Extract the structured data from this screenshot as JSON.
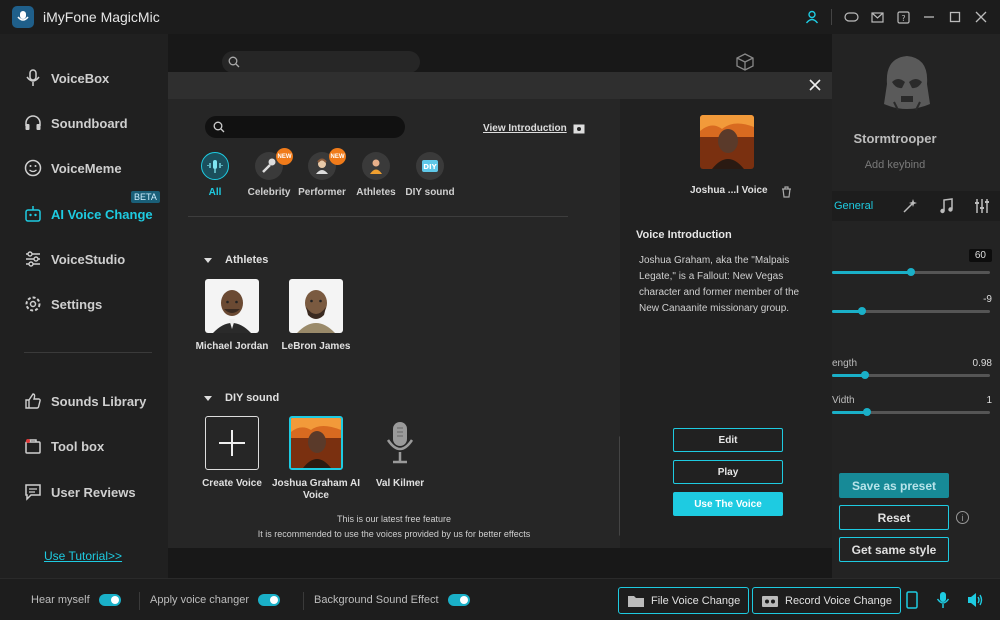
{
  "app": {
    "title": "iMyFone MagicMic"
  },
  "sidebar": {
    "items": [
      {
        "label": "VoiceBox",
        "icon": "microphone-icon"
      },
      {
        "label": "Soundboard",
        "icon": "headphones-icon"
      },
      {
        "label": "VoiceMeme",
        "icon": "smiley-icon"
      },
      {
        "label": "AI Voice Change",
        "icon": "robot-icon",
        "badge": "BETA"
      },
      {
        "label": "VoiceStudio",
        "icon": "sliders-icon"
      },
      {
        "label": "Settings",
        "icon": "gear-icon"
      },
      {
        "label": "Sounds Library",
        "icon": "thumbs-up-icon"
      },
      {
        "label": "Tool box",
        "icon": "toolbox-icon"
      },
      {
        "label": "User Reviews",
        "icon": "chat-icon"
      }
    ],
    "tutorial": "Use Tutorial>>"
  },
  "modal": {
    "view_intro": "View Introduction",
    "categories": [
      {
        "label": "All",
        "icon": "microphone-wave-icon"
      },
      {
        "label": "Celebrity",
        "icon": "celebrity-mic-icon",
        "badge": "NEW"
      },
      {
        "label": "Performer",
        "icon": "performer-icon",
        "badge": "NEW"
      },
      {
        "label": "Athletes",
        "icon": "athlete-icon"
      },
      {
        "label": "DIY sound",
        "icon": "diy-icon",
        "badge": "DIY"
      }
    ],
    "sections": {
      "athletes": {
        "title": "Athletes",
        "voices": [
          {
            "label": "Michael Jordan"
          },
          {
            "label": "LeBron James"
          }
        ]
      },
      "diy": {
        "title": "DIY sound",
        "voices": [
          {
            "label": "Create Voice"
          },
          {
            "label": "Joshua Graham AI Voice"
          },
          {
            "label": "Val Kilmer"
          }
        ]
      }
    },
    "footnote": [
      "This is our latest free feature",
      "It is recommended to use the voices provided by us for better effects"
    ],
    "detail": {
      "name": "Joshua ...l Voice",
      "intro_title": "Voice Introduction",
      "intro_text": "Joshua Graham, aka the \"Malpais Legate,\" is a Fallout: New Vegas character and former member of the New Canaanite missionary group.",
      "buttons": {
        "edit": "Edit",
        "play": "Play",
        "use": "Use The Voice"
      }
    }
  },
  "right_panel": {
    "name": "Stormtrooper",
    "keybind": "Add keybind",
    "tab_general": "General",
    "sliders": [
      {
        "label": "",
        "value": "60",
        "level": 0.5
      },
      {
        "label": "",
        "value": "-9",
        "level": 0.19
      },
      {
        "label": "ength",
        "value": "0.98",
        "level": 0.21
      },
      {
        "label": "Vidth",
        "value": "1",
        "level": 0.22
      }
    ],
    "buttons": {
      "save": "Save as preset",
      "reset": "Reset",
      "same_style": "Get same style"
    }
  },
  "bottom": {
    "hear_myself": "Hear myself",
    "apply_changer": "Apply voice changer",
    "bg_effect": "Background Sound Effect",
    "file_change": "File Voice Change",
    "record_change": "Record Voice Change"
  },
  "colors": {
    "accent": "#1ecbe1",
    "badge_new": "#f07b1a"
  }
}
